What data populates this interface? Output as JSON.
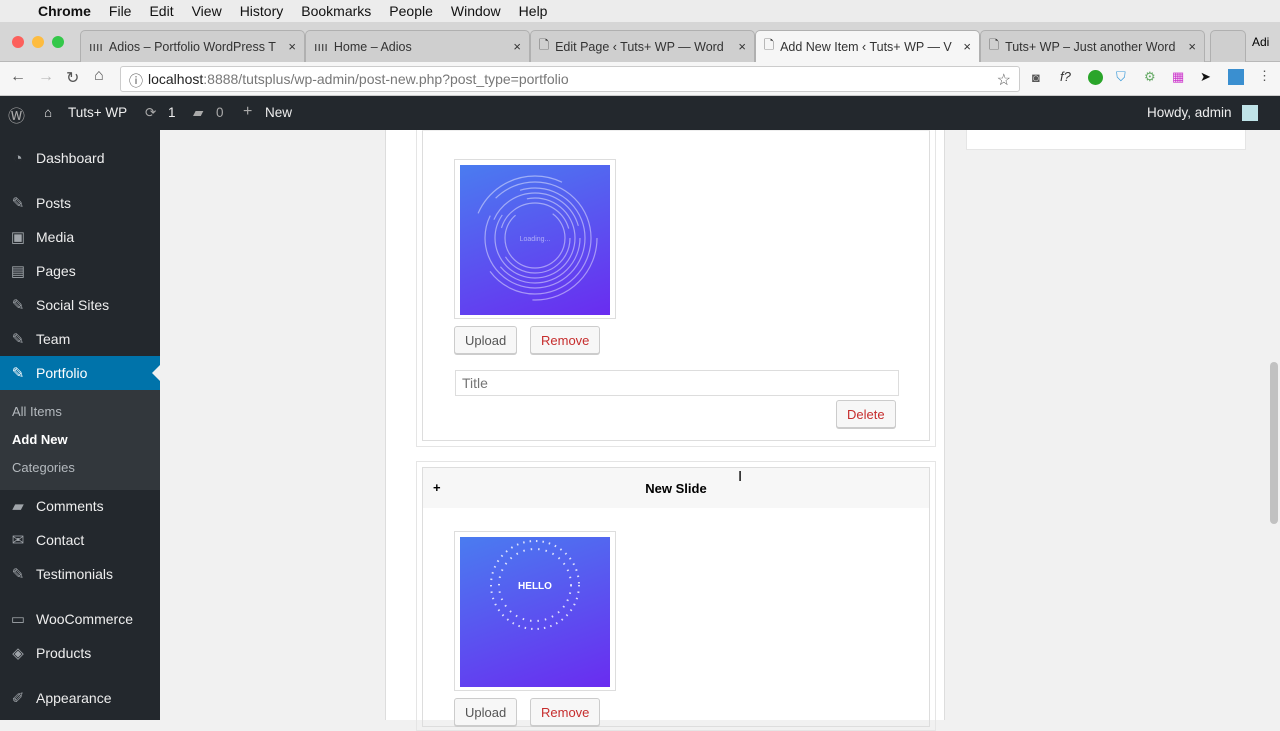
{
  "menubar": {
    "apple": "",
    "items": [
      "Chrome",
      "File",
      "Edit",
      "View",
      "History",
      "Bookmarks",
      "People",
      "Window",
      "Help"
    ]
  },
  "tabs": [
    {
      "title": "Adios – Portfolio WordPress T",
      "icon": "theme-icon"
    },
    {
      "title": "Home – Adios",
      "icon": "theme-icon"
    },
    {
      "title": "Edit Page ‹ Tuts+ WP — Word",
      "icon": "page-icon"
    },
    {
      "title": "Add New Item ‹ Tuts+ WP — V",
      "icon": "page-icon",
      "active": true
    },
    {
      "title": "Tuts+ WP – Just another Word",
      "icon": "page-icon"
    }
  ],
  "profile": "Adi",
  "address": {
    "host": "localhost",
    "rest": ":8888/tutsplus/wp-admin/post-new.php?post_type=portfolio"
  },
  "adminbar": {
    "site": "Tuts+ WP",
    "updates": "1",
    "comments": "0",
    "new": "New",
    "howdy": "Howdy, admin"
  },
  "sidebar": {
    "items": [
      {
        "label": "Dashboard",
        "icon": "◔"
      },
      {
        "label": "Posts",
        "icon": "✎"
      },
      {
        "label": "Media",
        "icon": "▣"
      },
      {
        "label": "Pages",
        "icon": "▤"
      },
      {
        "label": "Social Sites",
        "icon": "✎"
      },
      {
        "label": "Team",
        "icon": "✎"
      },
      {
        "label": "Portfolio",
        "icon": "✎"
      },
      {
        "label": "Comments",
        "icon": "▰"
      },
      {
        "label": "Contact",
        "icon": "✉"
      },
      {
        "label": "Testimonials",
        "icon": "✎"
      },
      {
        "label": "WooCommerce",
        "icon": "▭"
      },
      {
        "label": "Products",
        "icon": "◈"
      },
      {
        "label": "Appearance",
        "icon": "✐"
      }
    ],
    "submenu": [
      "All Items",
      "Add New",
      "Categories"
    ]
  },
  "slides": {
    "upload": "Upload",
    "remove": "Remove",
    "title_placeholder": "Title",
    "delete": "Delete",
    "new_slide": "New Slide",
    "toggle": "+",
    "loading_text": "Loading...",
    "hello_text": "HELLO"
  }
}
